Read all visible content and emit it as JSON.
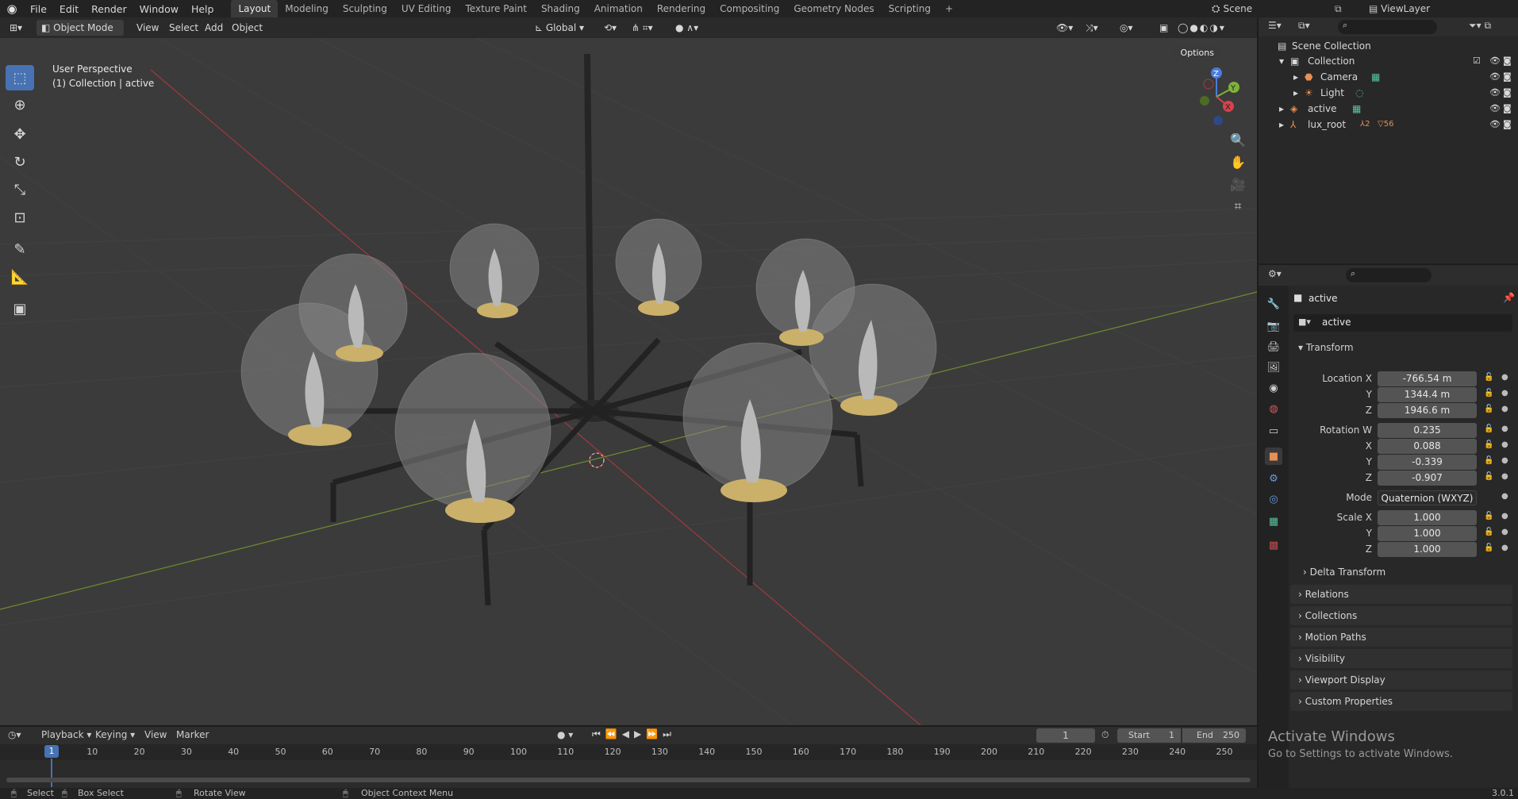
{
  "menu": [
    "File",
    "Edit",
    "Render",
    "Window",
    "Help"
  ],
  "workspaces": [
    "Layout",
    "Modeling",
    "Sculpting",
    "UV Editing",
    "Texture Paint",
    "Shading",
    "Animation",
    "Rendering",
    "Compositing",
    "Geometry Nodes",
    "Scripting",
    "+"
  ],
  "scene_label": "Scene",
  "viewlayer_label": "ViewLayer",
  "viewport_header": {
    "mode": "Object Mode",
    "view": "View",
    "select": "Select",
    "add": "Add",
    "object": "Object",
    "transform": "Global",
    "options": "Options"
  },
  "viewport": {
    "perspective": "User Perspective",
    "collection_info": "(1) Collection | active"
  },
  "gizmo": {
    "x": "X",
    "y": "Y",
    "z": "Z"
  },
  "outliner": {
    "root": "Scene Collection",
    "items": [
      {
        "label": "Collection"
      },
      {
        "label": "Camera"
      },
      {
        "label": "Light"
      },
      {
        "label": "active"
      },
      {
        "label": "lux_root",
        "badge1": "2",
        "badge2": "56"
      }
    ]
  },
  "properties": {
    "object_name": "active",
    "data_name": "active",
    "transform_title": "Transform",
    "location_label": "Location X",
    "location": [
      "-766.54 m",
      "1344.4 m",
      "1946.6 m"
    ],
    "rotation_label": "Rotation W",
    "rotation": [
      "0.235",
      "0.088",
      "-0.339",
      "-0.907"
    ],
    "mode_label": "Mode",
    "mode_value": "Quaternion (WXYZ)",
    "scale_label": "Scale X",
    "scale": [
      "1.000",
      "1.000",
      "1.000"
    ],
    "axis_y": "Y",
    "axis_z": "Z",
    "axis_x": "X",
    "delta": "Delta Transform",
    "panels": [
      "Relations",
      "Collections",
      "Motion Paths",
      "Visibility",
      "Viewport Display",
      "Custom Properties"
    ]
  },
  "timeline": {
    "playback": "Playback",
    "keying": "Keying",
    "view": "View",
    "marker": "Marker",
    "current_frame": "1",
    "start_label": "Start",
    "start": "1",
    "end_label": "End",
    "end": "250",
    "ticks": [
      "1",
      "10",
      "20",
      "30",
      "40",
      "50",
      "60",
      "70",
      "80",
      "90",
      "100",
      "110",
      "120",
      "130",
      "140",
      "150",
      "160",
      "170",
      "180",
      "190",
      "200",
      "210",
      "220",
      "230",
      "240",
      "250"
    ]
  },
  "activate": {
    "title": "Activate Windows",
    "sub": "Go to Settings to activate Windows."
  },
  "status": {
    "select": "Select",
    "box_select": "Box Select",
    "rotate_view": "Rotate View",
    "context_menu": "Object Context Menu",
    "version": "3.0.1"
  }
}
